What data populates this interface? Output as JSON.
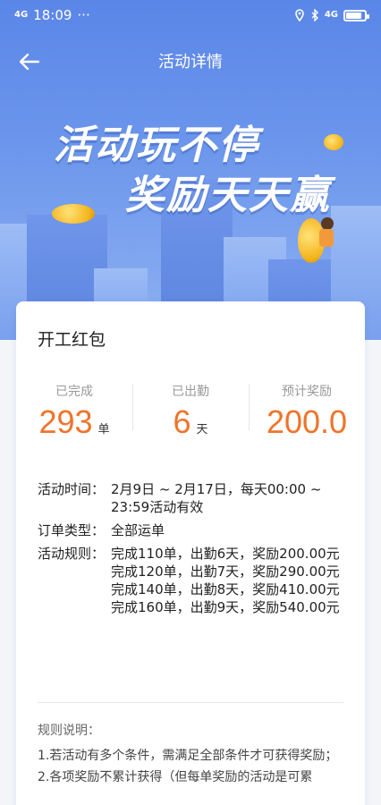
{
  "status": {
    "time": "18:09",
    "dots": "···",
    "network": "4G",
    "signal": "4G"
  },
  "nav": {
    "title": "活动详情"
  },
  "banner": {
    "line1": "活动玩不停",
    "line2": "奖励天天赢"
  },
  "card": {
    "title": "开工红包",
    "stats": [
      {
        "label": "已完成",
        "value": "293",
        "unit": "单"
      },
      {
        "label": "已出勤",
        "value": "6",
        "unit": "天"
      },
      {
        "label": "预计奖励",
        "value": "200.0",
        "unit": ""
      }
    ],
    "details": {
      "time_key": "活动时间：",
      "time_val": "2月9日 ~ 2月17日，每天00:00 ~ 23:59活动有效",
      "type_key": "订单类型：",
      "type_val": "全部运单",
      "rules_key": "活动规则：",
      "rules": [
        "完成110单，出勤6天，奖励200.00元",
        "完成120单，出勤7天，奖励290.00元",
        "完成140单，出勤8天，奖励410.00元",
        "完成160单，出勤9天，奖励540.00元"
      ]
    },
    "notes": {
      "head": "规则说明：",
      "items": [
        "1.若活动有多个条件，需满足全部条件才可获得奖励；",
        "2.各项奖励不累计获得（但每单奖励的活动是可累"
      ]
    }
  }
}
